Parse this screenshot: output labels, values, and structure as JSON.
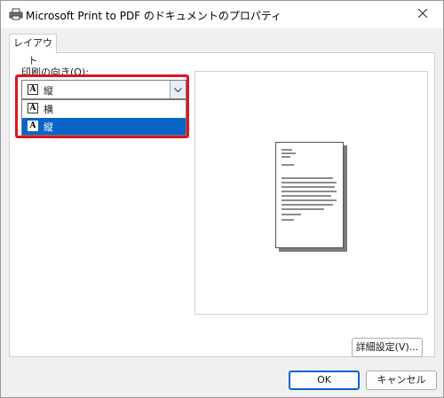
{
  "window": {
    "title": "Microsoft Print to PDF のドキュメントのプロパティ",
    "icons": {
      "app": "printer-icon",
      "close": "close-icon"
    }
  },
  "tabs": [
    {
      "label": "レイアウト",
      "active": true
    }
  ],
  "orientation": {
    "label_prefix": "印刷の向き(",
    "label_accel": "O",
    "label_suffix": "):",
    "selected": "縦",
    "options": [
      {
        "label": "横",
        "icon": "landscape-icon",
        "highlighted": false
      },
      {
        "label": "縦",
        "icon": "portrait-icon",
        "highlighted": true
      }
    ],
    "highlight_color": "#e0141e",
    "selection_color": "#0a64c8"
  },
  "buttons": {
    "advanced": "詳細設定(V)...",
    "ok": "OK",
    "cancel": "キャンセル"
  }
}
